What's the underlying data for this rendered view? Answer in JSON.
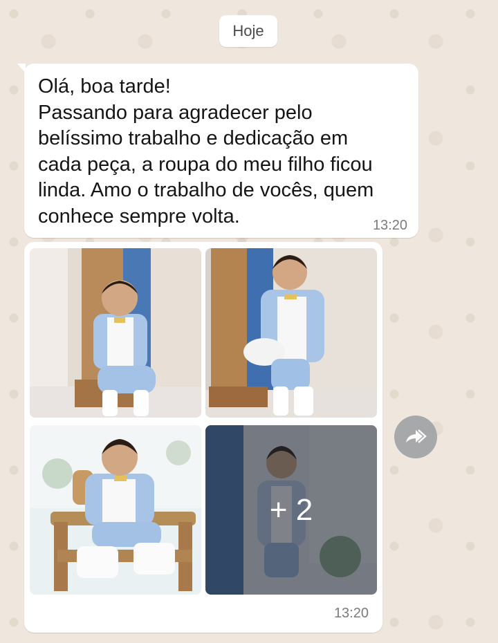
{
  "date_chip": "Hoje",
  "messages": {
    "text": {
      "body": "Olá, boa tarde!\nPassando para agradecer pelo\nbelíssimo trabalho e dedicação em\ncada peça, a roupa do meu filho ficou\nlinda. Amo o trabalho de vocês, quem\nconhece sempre volta.",
      "time": "13:20"
    },
    "media": {
      "more_count": "+ 2",
      "time": "13:20"
    }
  },
  "icons": {
    "forward": "forward-icon"
  },
  "colors": {
    "wallpaper": "#efe7dd",
    "bubble": "#ffffff",
    "timestamp": "#7b7b7b"
  }
}
